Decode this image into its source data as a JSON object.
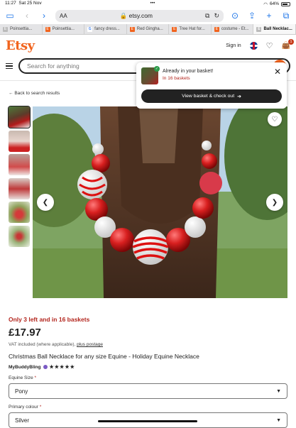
{
  "status_bar": {
    "time": "11:27",
    "date": "Sat 25 Nov",
    "battery": "64%",
    "dots": "•••"
  },
  "safari": {
    "address": "etsy.com",
    "aa": "AA"
  },
  "tabs": [
    {
      "label": "Poinsettia..."
    },
    {
      "label": "fancy dress..."
    },
    {
      "label": "Red Gingha..."
    },
    {
      "label": "Tree Hat for..."
    },
    {
      "label": "costume - Et..."
    },
    {
      "label": "Ball Necklac..."
    }
  ],
  "etsy": {
    "logo": "Etsy",
    "sign_in": "Sign in",
    "basket_count": "1",
    "search_placeholder": "Search for anything"
  },
  "popup": {
    "title": "Already in your basket!",
    "sub": "In 16 baskets",
    "cta": "View basket & check out"
  },
  "back_link": "Back to search results",
  "product": {
    "stock": "Only 3 left and in 16 baskets",
    "price": "£17.97",
    "vat_prefix": "VAT included (where applicable),",
    "vat_link": "plus postage",
    "title": "Christmas Ball Necklace for any size Equine - Holiday Equine Necklace",
    "seller": "MyBuddyBling",
    "stars": "★★★★★",
    "size_label": "Equine Size",
    "size_value": "Pony",
    "colour_label": "Primary colour",
    "colour_value": "Silver"
  }
}
